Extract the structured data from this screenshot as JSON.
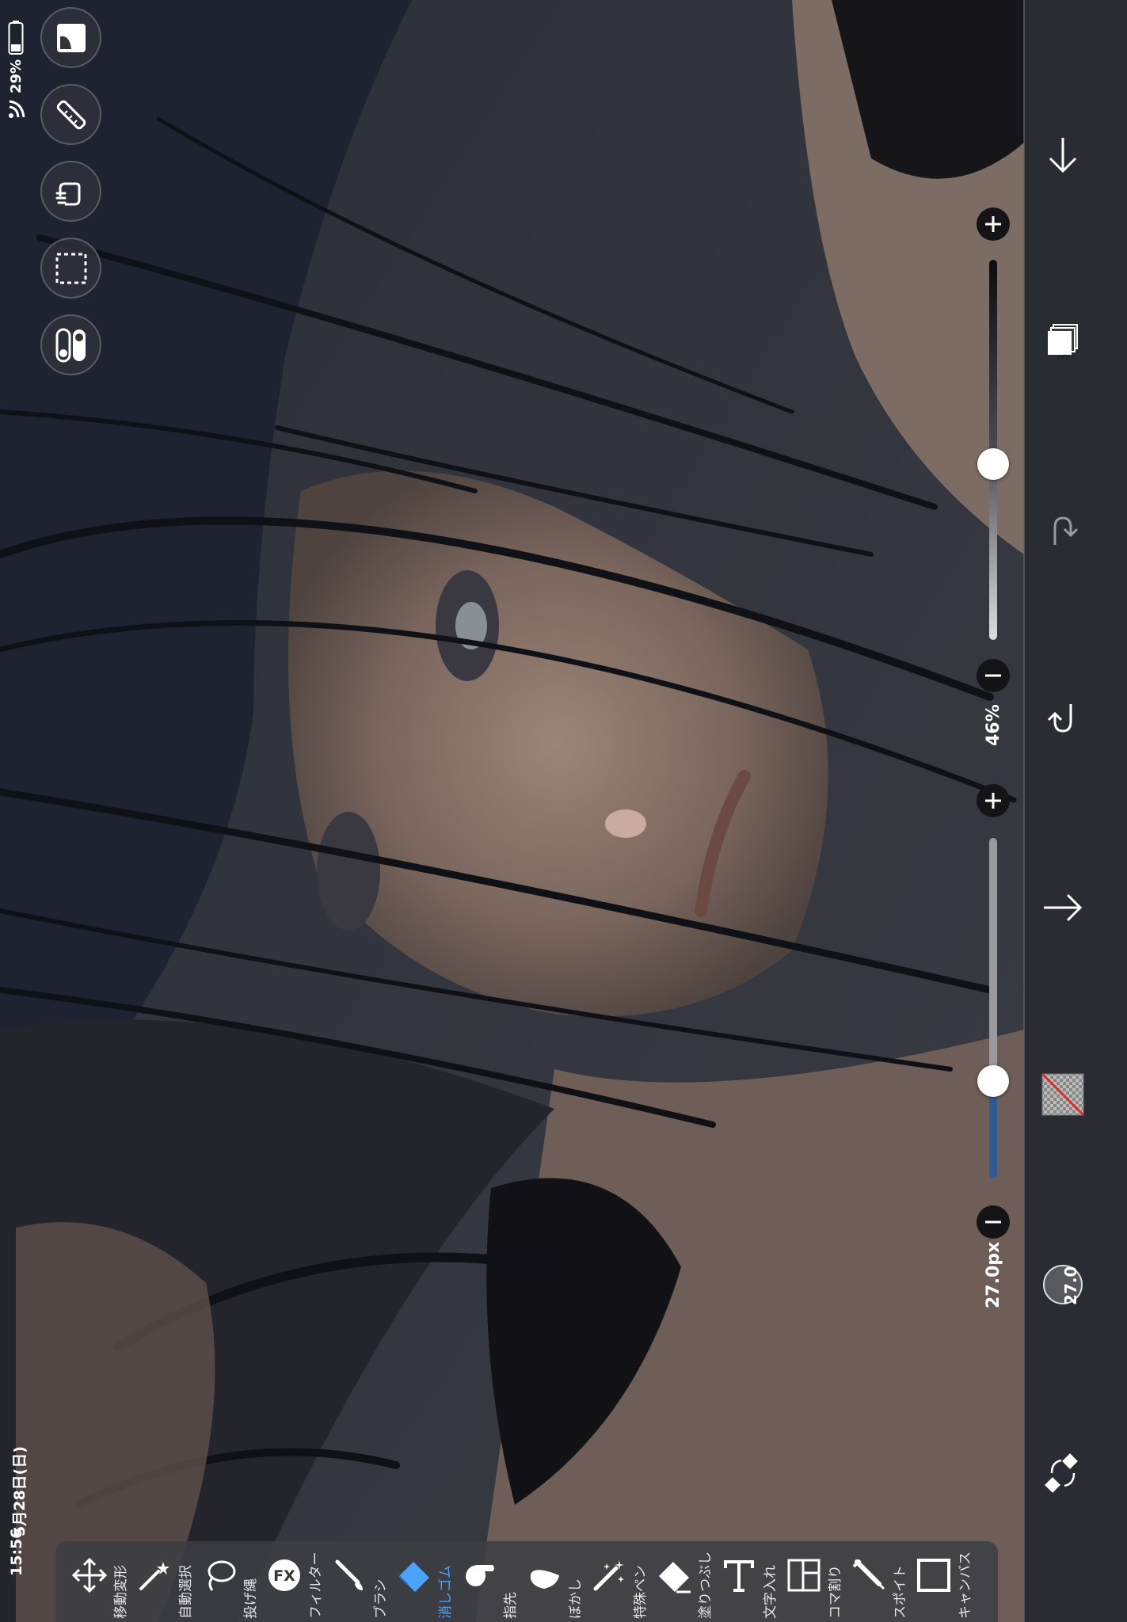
{
  "status_bar": {
    "time": "15:56",
    "date": "5月28日(日)",
    "battery": "29%"
  },
  "left_tools": [
    {
      "name": "navigator-icon"
    },
    {
      "name": "ruler-icon"
    },
    {
      "name": "hand-icon"
    },
    {
      "name": "selection-icon"
    },
    {
      "name": "toggle-icon"
    }
  ],
  "right_panel": {
    "layer_count": "3",
    "brush_size_badge": "27.0"
  },
  "sliders": {
    "opacity": {
      "value_label": "46%",
      "level": 0.46
    },
    "brush_size": {
      "value_label": "27.0px",
      "level": 0.27
    }
  },
  "toolbar": {
    "tools": [
      {
        "label": "移動変形",
        "icon": "move-icon"
      },
      {
        "label": "自動選択",
        "icon": "magic-wand-icon"
      },
      {
        "label": "投げ縄",
        "icon": "lasso-icon"
      },
      {
        "label": "フィルター",
        "icon": "fx-icon"
      },
      {
        "label": "ブラシ",
        "icon": "brush-icon"
      },
      {
        "label": "消しゴム",
        "icon": "eraser-icon",
        "active": true
      },
      {
        "label": "指先",
        "icon": "finger-icon"
      },
      {
        "label": "ぼかし",
        "icon": "blur-icon"
      },
      {
        "label": "特殊ペン",
        "icon": "special-pen-icon"
      },
      {
        "label": "塗りつぶし",
        "icon": "fill-icon"
      },
      {
        "label": "文字入れ",
        "icon": "text-icon"
      },
      {
        "label": "コマ割り",
        "icon": "frame-divider-icon"
      },
      {
        "label": "スポイト",
        "icon": "eyedropper-icon"
      },
      {
        "label": "キャンバス",
        "icon": "canvas-icon"
      }
    ],
    "accent_color": "#4aa3ff"
  }
}
